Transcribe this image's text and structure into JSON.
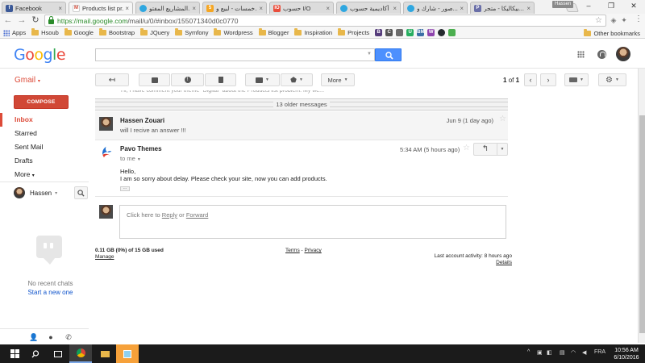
{
  "browser": {
    "tabs": [
      {
        "title": "Facebook",
        "favicon_color": "#3b5998",
        "favicon_char": "f",
        "active": false
      },
      {
        "title": "Products list pr...",
        "favicon_color": "#ffffff",
        "favicon_char": "M",
        "active": true
      },
      {
        "title": "المشاريع المفتو...",
        "favicon_color": "#2fa7e0",
        "favicon_char": "",
        "active": false
      },
      {
        "title": "خمسات - لبيع و...",
        "favicon_color": "#f5a623",
        "favicon_char": "5",
        "active": false
      },
      {
        "title": "حسوب I/O",
        "favicon_color": "#e94e3c",
        "favicon_char": "IO",
        "active": false
      },
      {
        "title": "أكاديمية حسوب",
        "favicon_color": "#2fa7e0",
        "favicon_char": "",
        "active": false
      },
      {
        "title": "صور - شارك و...",
        "favicon_color": "#2fa7e0",
        "favicon_char": "",
        "active": false
      },
      {
        "title": "بيكاليكا - متجر...",
        "favicon_color": "#6a6fa8",
        "favicon_char": "P",
        "active": false
      }
    ],
    "profile": "Hassen",
    "url_secure": "https://mail.google.com",
    "url_path": "/mail/u/0/#inbox/155071340d0c0770",
    "bookmarks": [
      {
        "label": "Apps",
        "type": "apps"
      },
      {
        "label": "Hsoub",
        "type": "folder"
      },
      {
        "label": "Google",
        "type": "folder"
      },
      {
        "label": "Bootstrap",
        "type": "folder"
      },
      {
        "label": "JQuery",
        "type": "folder"
      },
      {
        "label": "Symfony",
        "type": "folder"
      },
      {
        "label": "Wordpress",
        "type": "folder"
      },
      {
        "label": "Blogger",
        "type": "folder"
      },
      {
        "label": "Inspiration",
        "type": "folder"
      },
      {
        "label": "Projects",
        "type": "folder"
      }
    ],
    "bookmark_icons": [
      {
        "char": "B",
        "color": "#563d7c"
      },
      {
        "char": "C",
        "color": "#555555"
      },
      {
        "char": "",
        "color": "#6b6b6b"
      },
      {
        "char": "U",
        "color": "#27ae60"
      },
      {
        "char": "BM",
        "color": "#3a6ea5"
      },
      {
        "char": "W",
        "color": "#8e44ad"
      },
      {
        "char": "",
        "color": "#24292e"
      },
      {
        "char": "",
        "color": "#4caf50"
      }
    ],
    "other_bookmarks": "Other bookmarks"
  },
  "gmail": {
    "label": "Gmail",
    "compose": "COMPOSE",
    "nav": [
      {
        "label": "Inbox",
        "active": true
      },
      {
        "label": "Starred",
        "active": false
      },
      {
        "label": "Sent Mail",
        "active": false
      },
      {
        "label": "Drafts",
        "active": false
      },
      {
        "label": "More",
        "active": false
      }
    ],
    "hangouts_user": "Hassen",
    "no_chats": "No recent chats",
    "start_new": "Start a new one",
    "toolbar_more": "More",
    "pager": {
      "range": "1",
      "of": "of",
      "total": "1"
    }
  },
  "conversation": {
    "top_snippet": "Hi, I have comment your theme \"Digital\" about the Products list problem. My we...",
    "older_count": "13 older messages",
    "messages": [
      {
        "sender": "Hassen Zouari",
        "snippet": "will I recive an answer !!!",
        "date": "Jun 9 (1 day ago)"
      },
      {
        "sender": "Pavo Themes",
        "to": "to me",
        "date": "5:34 AM (5 hours ago)",
        "body": [
          "Hello,",
          "I am so sorry about delay. Please check your site, now you can add products."
        ]
      }
    ],
    "reply": {
      "prefix": "Click here to ",
      "reply": "Reply",
      "or": " or ",
      "forward": "Forward"
    }
  },
  "footer": {
    "quota": "0.11 GB (0%) of 15 GB used",
    "manage": "Manage",
    "terms": "Terms",
    "sep": " - ",
    "privacy": "Privacy",
    "last_activity": "Last account activity: 8 hours ago",
    "details": "Details"
  },
  "taskbar": {
    "lang": "FRA",
    "time": "10:56 AM",
    "date": "6/10/2016"
  },
  "colors": {
    "accent_red": "#dd4b39",
    "search_blue": "#4d90fe",
    "secure_green": "#2a8b2a"
  }
}
